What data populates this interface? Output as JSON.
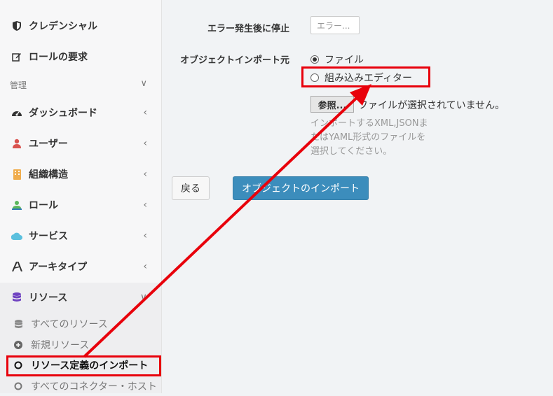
{
  "sidebar": {
    "items_top": [
      {
        "label": "クレデンシャル",
        "icon": "shield-icon"
      },
      {
        "label": "ロールの要求",
        "icon": "edit-icon"
      }
    ],
    "section_label": "管理",
    "section_chevron": "∨",
    "items": [
      {
        "label": "ダッシュボード",
        "icon": "dashboard-icon",
        "icon_color": "#333333",
        "chevron": "‹"
      },
      {
        "label": "ユーザー",
        "icon": "user-icon",
        "icon_color": "#d9534f",
        "chevron": "‹"
      },
      {
        "label": "組織構造",
        "icon": "building-icon",
        "icon_color": "#f0ad4e",
        "chevron": "‹"
      },
      {
        "label": "ロール",
        "icon": "role-icon",
        "icon_color": "#5cb85c",
        "chevron": "‹"
      },
      {
        "label": "サービス",
        "icon": "cloud-icon",
        "icon_color": "#5bc0de",
        "chevron": "‹"
      },
      {
        "label": "アーキタイプ",
        "icon": "archetype-icon",
        "icon_color": "#333333",
        "chevron": "‹"
      },
      {
        "label": "リソース",
        "icon": "database-icon",
        "icon_color": "#6f42c1",
        "chevron": "∨"
      }
    ],
    "sub_items": [
      {
        "label": "すべてのリソース",
        "icon": "database-icon"
      },
      {
        "label": "新規リソース",
        "icon": "plus-circle-icon"
      },
      {
        "label": "リソース定義のインポート",
        "icon": "circle-icon",
        "active": true
      },
      {
        "label": "すべてのコネクター・ホスト",
        "icon": "circle-icon"
      }
    ]
  },
  "form": {
    "stop_label": "エラー発生後に停止",
    "stop_placeholder": "エラー...",
    "import_from_label": "オブジェクトインポート元",
    "options": [
      {
        "label": "ファイル",
        "checked": true
      },
      {
        "label": "組み込みエディター",
        "checked": false
      }
    ],
    "file_button": "参照...",
    "file_status": "ファイルが選択されていません。",
    "help_text": "インポートするXML,JSONまたはYAML形式のファイルを選択してください。",
    "back_button": "戻る",
    "import_button": "オブジェクトのインポート"
  },
  "colors": {
    "highlight": "#e8000b",
    "primary": "#3c8dbc"
  }
}
